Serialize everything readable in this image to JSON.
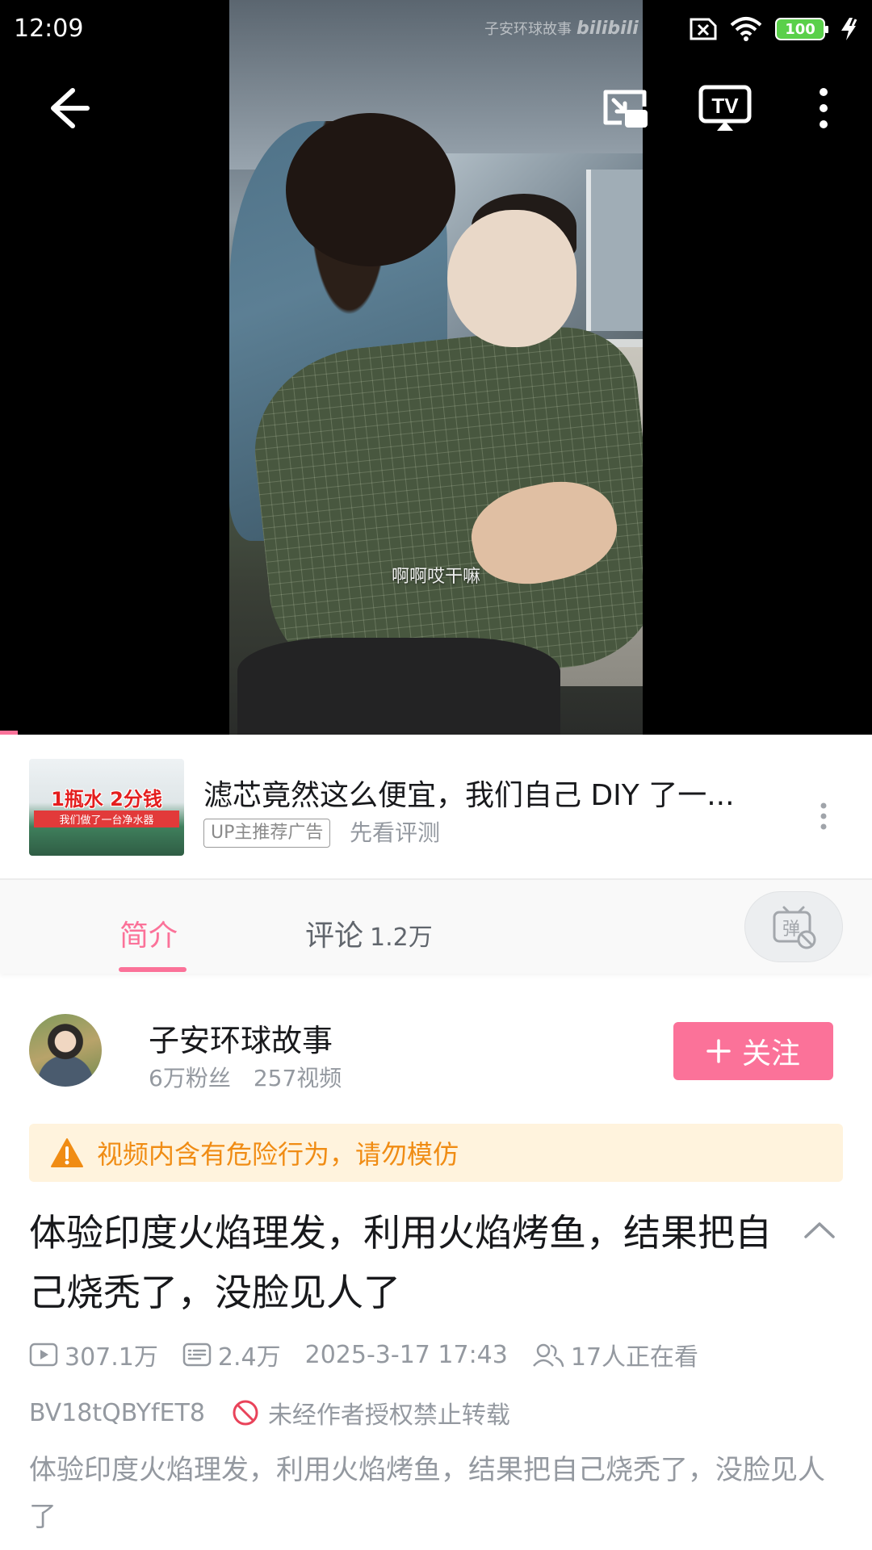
{
  "status_bar": {
    "time": "12:09",
    "battery": "100"
  },
  "video": {
    "watermark_name": "子安环球故事",
    "watermark_brand": "bilibili",
    "subtitle": "啊啊哎干嘛",
    "progress_fraction": 0.02
  },
  "ad": {
    "thumb_line1": "1瓶水 2分钱",
    "thumb_line2": "我们做了一台净水器",
    "title": "滤芯竟然这么便宜，我们自己 DIY 了一...",
    "tag": "UP主推荐广告",
    "subtitle": "先看评测"
  },
  "tabs": {
    "intro": "简介",
    "comments": "评论",
    "comments_count": "1.2万",
    "danmaku_glyph": "弹"
  },
  "author": {
    "name": "子安环球故事",
    "fans": "6万粉丝",
    "videos": "257视频",
    "follow_label": "关注"
  },
  "warning": {
    "text": "视频内含有危险行为，请勿模仿"
  },
  "video_info": {
    "title": "体验印度火焰理发，利用火焰烤鱼，结果把自己烧秃了，没脸见人了",
    "views": "307.1万",
    "danmaku": "2.4万",
    "datetime": "2025-3-17 17:43",
    "watching": "17人正在看",
    "bvid": "BV18tQBYfET8",
    "no_reprint": "未经作者授权禁止转载",
    "description": "体验印度火焰理发，利用火焰烤鱼，结果把自己烧秃了，没脸见人了"
  },
  "colors": {
    "accent": "#fb7299",
    "warning_text": "#f08c14",
    "warning_bg": "#fff3dd",
    "muted_text": "#9499a0",
    "primary_text": "#18191c",
    "no_reprint_icon": "#e9435a"
  },
  "icons": {
    "back": "back-arrow-icon",
    "pip": "picture-in-picture-icon",
    "tv": "tv-cast-icon",
    "more": "more-vertical-icon",
    "warning": "warning-triangle-icon",
    "views": "play-count-icon",
    "danmaku": "danmaku-count-icon",
    "watching": "people-watching-icon",
    "no_reprint": "no-entry-icon",
    "collapse": "chevron-up-icon"
  }
}
